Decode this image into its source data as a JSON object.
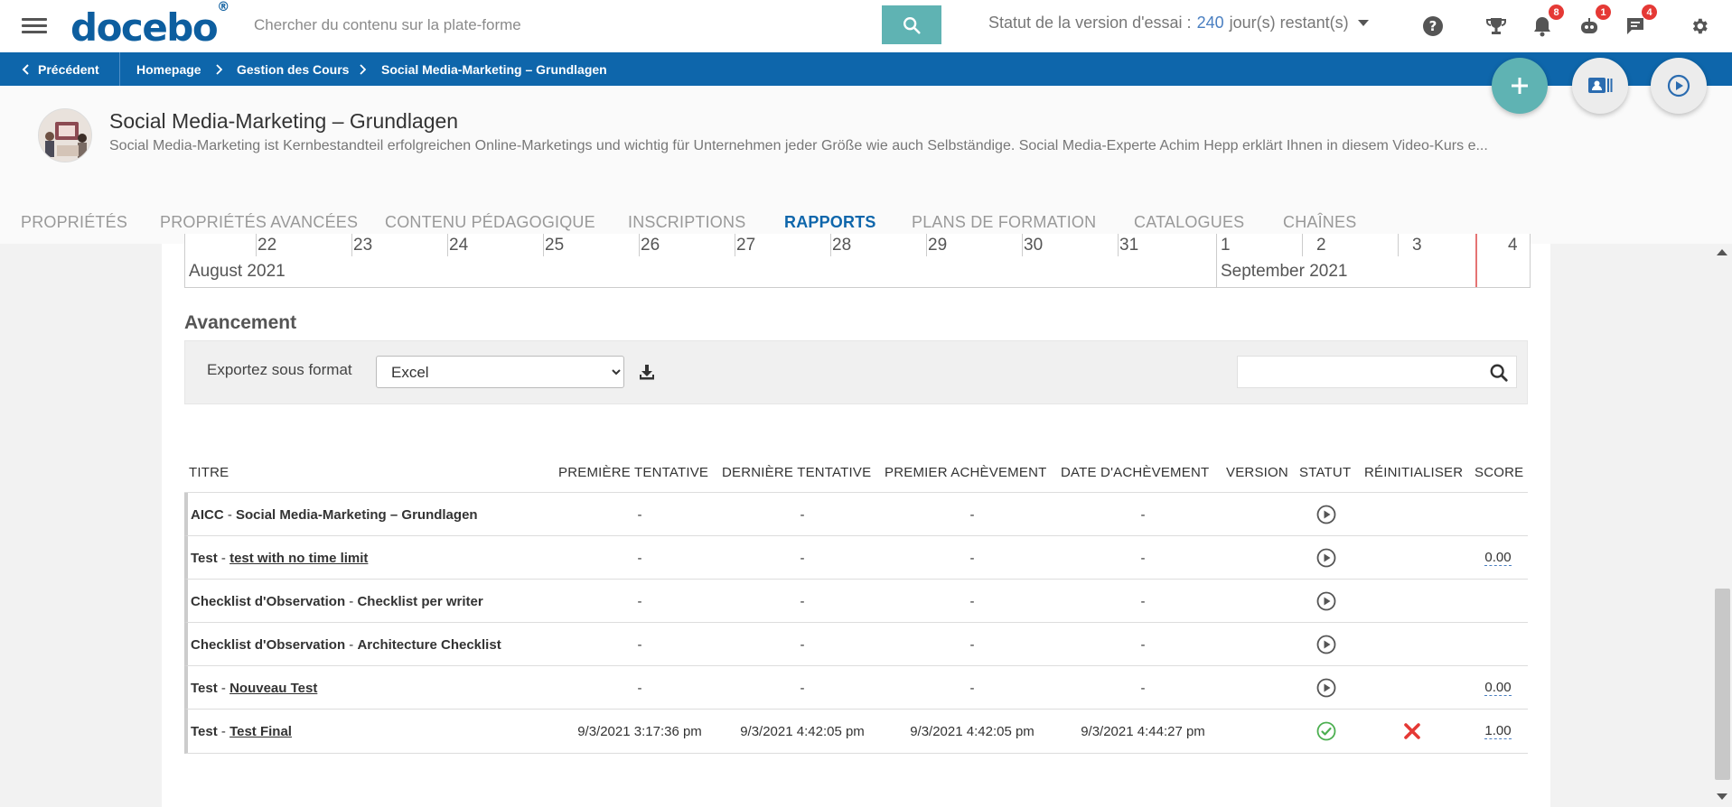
{
  "topbar": {
    "logo": "docebo",
    "logo_mark": "®",
    "search_placeholder": "Chercher du contenu sur la plate-forme",
    "trial_prefix": "Statut de la version d'essai :",
    "trial_days": "240",
    "trial_suffix": "jour(s) restant(s)",
    "notifications_count": "8",
    "robot_count": "1",
    "messages_count": "4",
    "accent_color": "#5fb3b3",
    "brand_color": "#0e66ab"
  },
  "breadcrumb": {
    "back_label": "Précédent",
    "items": [
      "Homepage",
      "Gestion des Cours",
      "Social Media-Marketing – Grundlagen"
    ]
  },
  "course": {
    "title": "Social Media-Marketing – Grundlagen",
    "description": "Social Media-Marketing ist Kernbestandteil erfolgreichen Online-Marketings und wichtig für Unternehmen jeder Größe wie auch Selbständige. Social Media-Experte Achim Hepp erklärt Ihnen in diesem Video-Kurs e..."
  },
  "tabs": [
    {
      "label": "PROPRIÉTÉS"
    },
    {
      "label": "PROPRIÉTÉS AVANCÉES"
    },
    {
      "label": "CONTENU PÉDAGOGIQUE"
    },
    {
      "label": "INSCRIPTIONS"
    },
    {
      "label": "RAPPORTS",
      "active": true
    },
    {
      "label": "PLANS DE FORMATION"
    },
    {
      "label": "CATALOGUES"
    },
    {
      "label": "CHAÎNES"
    }
  ],
  "timeline": {
    "days": [
      "22",
      "23",
      "24",
      "25",
      "26",
      "27",
      "28",
      "29",
      "30",
      "31",
      "1",
      "2",
      "3",
      "4"
    ],
    "month_1": "August 2021",
    "month_2": "September 2021"
  },
  "progress": {
    "section_title": "Avancement",
    "export_label": "Exportez sous format",
    "export_value": "Excel",
    "columns": [
      "TITRE",
      "PREMIÈRE TENTATIVE",
      "DERNIÈRE TENTATIVE",
      "PREMIER ACHÈVEMENT",
      "DATE D'ACHÈVEMENT",
      "VERSION",
      "STATUT",
      "RÉINITIALISER",
      "SCORE"
    ],
    "rows": [
      {
        "type": "AICC",
        "sep": " - ",
        "name": "Social Media-Marketing – Grundlagen",
        "first": "-",
        "last": "-",
        "first_done": "-",
        "done_date": "-",
        "version": "",
        "status": "play-icon",
        "score": ""
      },
      {
        "type": "Test",
        "sep": " - ",
        "name": "test with no time limit",
        "first": "-",
        "last": "-",
        "first_done": "-",
        "done_date": "-",
        "version": "",
        "status": "play-icon",
        "score": "0.00"
      },
      {
        "type": "Checklist d'Observation",
        "sep": " - ",
        "name": "Checklist per writer",
        "first": "-",
        "last": "-",
        "first_done": "-",
        "done_date": "-",
        "version": "",
        "status": "play-icon",
        "score": ""
      },
      {
        "type": "Checklist d'Observation",
        "sep": " - ",
        "name": "Architecture Checklist",
        "first": "-",
        "last": "-",
        "first_done": "-",
        "done_date": "-",
        "version": "",
        "status": "play-icon",
        "score": ""
      },
      {
        "type": "Test",
        "sep": " - ",
        "name": "Nouveau Test",
        "first": "-",
        "last": "-",
        "first_done": "-",
        "done_date": "-",
        "version": "",
        "status": "play-icon",
        "score": "0.00"
      },
      {
        "type": "Test",
        "sep": " - ",
        "name": "Test Final",
        "first": "9/3/2021 3:17:36 pm",
        "last": "9/3/2021 4:42:05 pm",
        "first_done": "9/3/2021 4:42:05 pm",
        "done_date": "9/3/2021 4:44:27 pm",
        "version": "",
        "status": "check-circle-icon",
        "reset": "reset-x-icon",
        "score": "1.00"
      }
    ]
  }
}
